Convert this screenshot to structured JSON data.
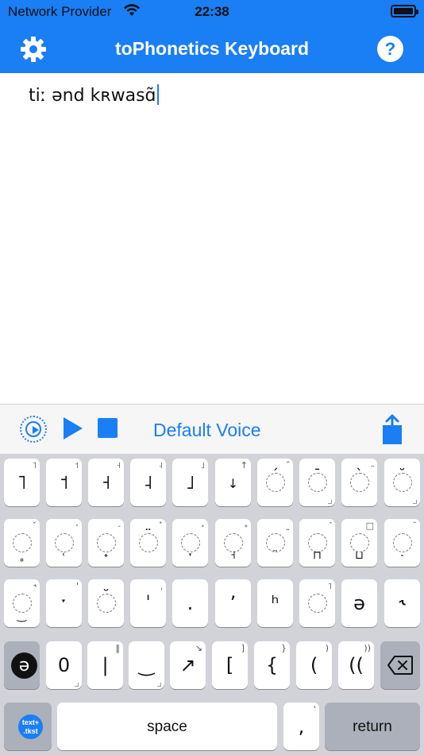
{
  "status_bar": {
    "carrier": "Network Provider",
    "time": "22:38",
    "wifi_icon": "wifi-icon",
    "battery_icon": "battery-icon"
  },
  "navbar": {
    "title": "toPhonetics Keyboard",
    "settings_icon": "gear-icon",
    "help_label": "?"
  },
  "editor": {
    "text": "tiː ənd kʀwasɑ̃"
  },
  "toolbar": {
    "voice_icon": "voice-select-icon",
    "play_icon": "play-icon",
    "stop_icon": "stop-icon",
    "voice_label": "Default Voice",
    "share_icon": "share-icon"
  },
  "keyboard": {
    "row1": [
      {
        "label": "˥",
        "sup": "˥"
      },
      {
        "label": "˦",
        "sup": "˦"
      },
      {
        "label": "˧",
        "sup": "˧"
      },
      {
        "label": "˨",
        "sup": "˨"
      },
      {
        "label": "˩",
        "sup": "˩"
      },
      {
        "label": "↓",
        "sup": "↑"
      },
      {
        "label": "◌́",
        "sup": "̋"
      },
      {
        "label": "◌̄",
        "sup": ""
      },
      {
        "label": "◌̀",
        "sup": "̏"
      },
      {
        "label": "◌̆",
        "sup": ""
      }
    ],
    "row2": [
      {
        "label": "◌̥",
        "sup": "ˇ"
      },
      {
        "label": "◌̜",
        "sup": "˓"
      },
      {
        "label": "◌̟",
        "sup": "˗"
      },
      {
        "label": "◌̈",
        "sup": "˟"
      },
      {
        "label": "◌̞",
        "sup": "˔"
      },
      {
        "label": "◌̘",
        "sup": "˖"
      },
      {
        "label": "◌̤",
        "sup": "˷"
      },
      {
        "label": "◌̪",
        "sup": "˺"
      },
      {
        "label": "◌̺",
        "sup": "□"
      },
      {
        "label": "◌̠",
        "sup": "˘"
      }
    ],
    "row3": [
      {
        "label": "◌̼",
        "sup": "˞"
      },
      {
        "label": "ˑ",
        "sup": "'"
      },
      {
        "label": "◌̆",
        "sup": ""
      },
      {
        "label": "ˈ",
        "sup": "ˌ"
      },
      {
        "label": ".",
        "sup": ""
      },
      {
        "label": "ʼ",
        "sup": ""
      },
      {
        "label": "ʰ",
        "sup": ""
      },
      {
        "label": "◌̚",
        "sup": ""
      },
      {
        "label": "ə",
        "sup": ""
      },
      {
        "label": "˞",
        "sup": ""
      }
    ],
    "row4": {
      "schwa_label": "ə",
      "keys": [
        {
          "label": "0",
          "sup": ""
        },
        {
          "label": "|",
          "sup": "‖"
        },
        {
          "label": "‿",
          "sup": ""
        },
        {
          "label": "↗",
          "sup": "↘"
        },
        {
          "label": "[",
          "sup": "]"
        },
        {
          "label": "{",
          "sup": "}"
        },
        {
          "label": "(",
          "sup": ")"
        },
        {
          "label": "((",
          "sup": "))"
        }
      ],
      "delete_icon": "delete-backspace-icon"
    },
    "row5": {
      "logo_label_top": "text+",
      "logo_label_bottom": ".tkst",
      "space_label": "space",
      "comma_label": ",",
      "comma_sup": "'",
      "return_label": "return"
    }
  }
}
